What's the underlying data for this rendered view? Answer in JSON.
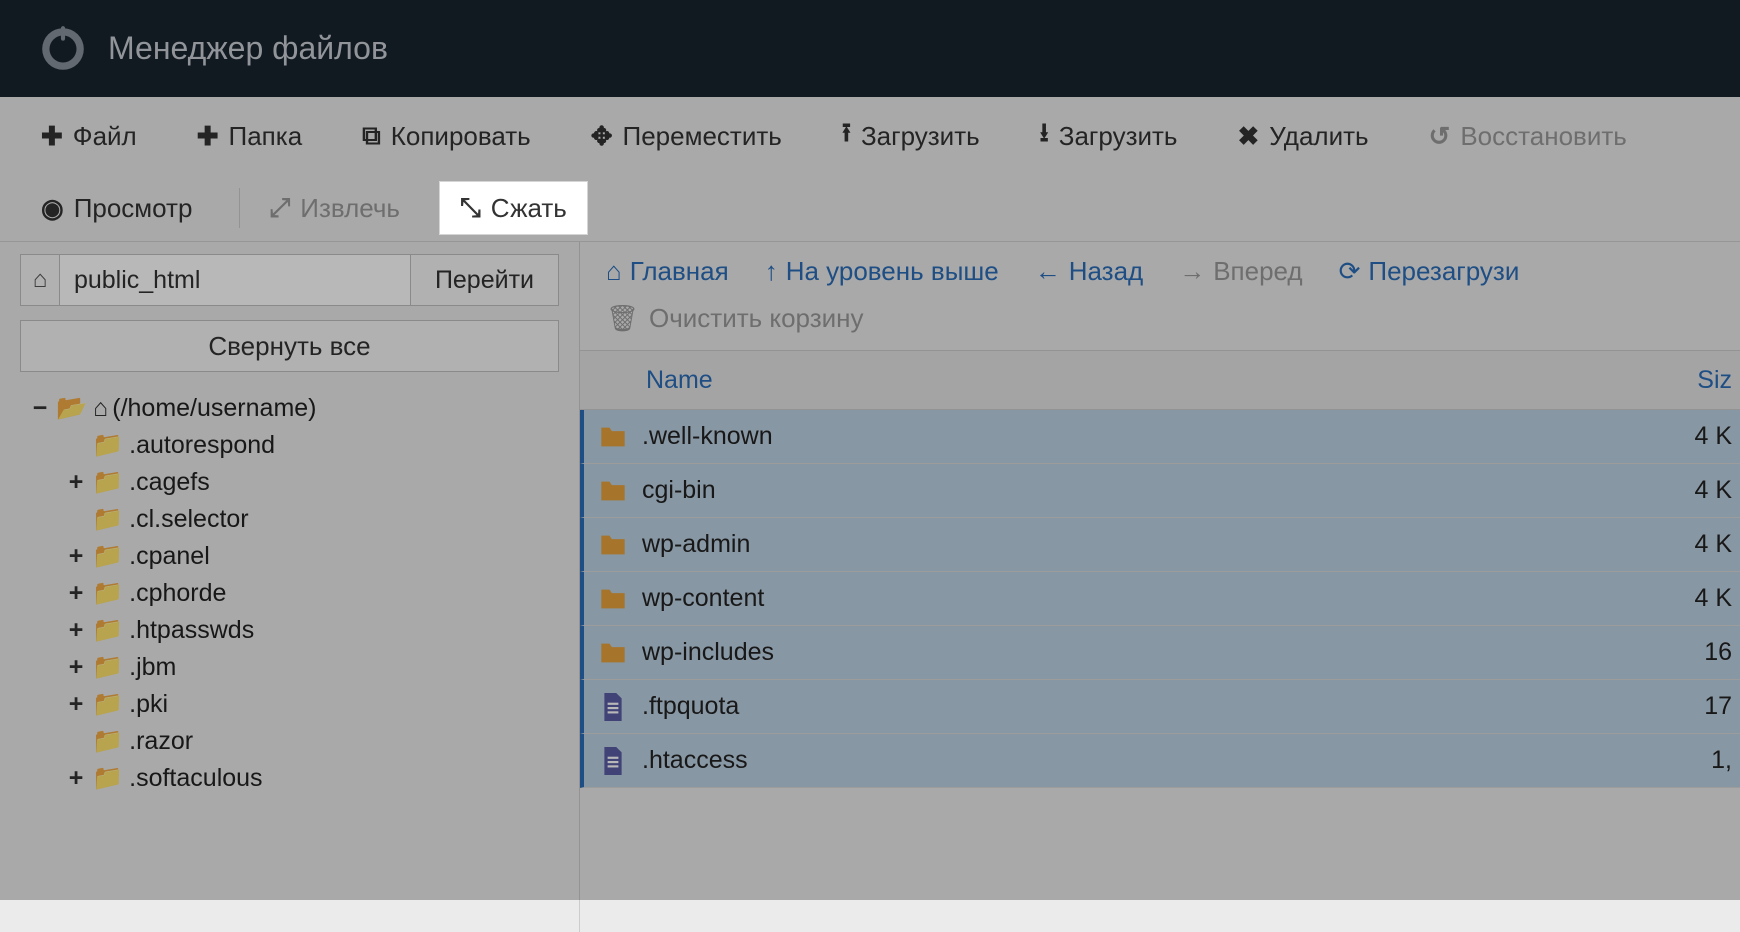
{
  "header": {
    "title": "Менеджер файлов"
  },
  "toolbar": {
    "file": "Файл",
    "folder": "Папка",
    "copy": "Копировать",
    "move": "Переместить",
    "upload": "Загрузить",
    "download": "Загрузить",
    "delete": "Удалить",
    "restore": "Восстановить",
    "view": "Просмотр",
    "extract": "Извлечь",
    "compress": "Сжать"
  },
  "sidebar": {
    "path_value": "public_html",
    "go": "Перейти",
    "collapse_all": "Свернуть все",
    "tree": {
      "root": "(/home/username)",
      "children": [
        {
          "name": ".autorespond",
          "expandable": false
        },
        {
          "name": ".cagefs",
          "expandable": true
        },
        {
          "name": ".cl.selector",
          "expandable": false
        },
        {
          "name": ".cpanel",
          "expandable": true
        },
        {
          "name": ".cphorde",
          "expandable": true
        },
        {
          "name": ".htpasswds",
          "expandable": true
        },
        {
          "name": ".jbm",
          "expandable": true
        },
        {
          "name": ".pki",
          "expandable": true
        },
        {
          "name": ".razor",
          "expandable": false
        },
        {
          "name": ".softaculous",
          "expandable": true
        }
      ]
    }
  },
  "nav": {
    "home": "Главная",
    "up": "На уровень выше",
    "back": "Назад",
    "forward": "Вперед",
    "reload": "Перезагрузи",
    "empty_trash": "Очистить корзину"
  },
  "table": {
    "col_name": "Name",
    "col_size": "Siz",
    "rows": [
      {
        "name": ".well-known",
        "type": "folder",
        "size": "4 K"
      },
      {
        "name": "cgi-bin",
        "type": "folder",
        "size": "4 K"
      },
      {
        "name": "wp-admin",
        "type": "folder",
        "size": "4 K"
      },
      {
        "name": "wp-content",
        "type": "folder",
        "size": "4 K"
      },
      {
        "name": "wp-includes",
        "type": "folder",
        "size": "16"
      },
      {
        "name": ".ftpquota",
        "type": "file",
        "size": "17"
      },
      {
        "name": ".htaccess",
        "type": "file",
        "size": "1,"
      }
    ]
  }
}
